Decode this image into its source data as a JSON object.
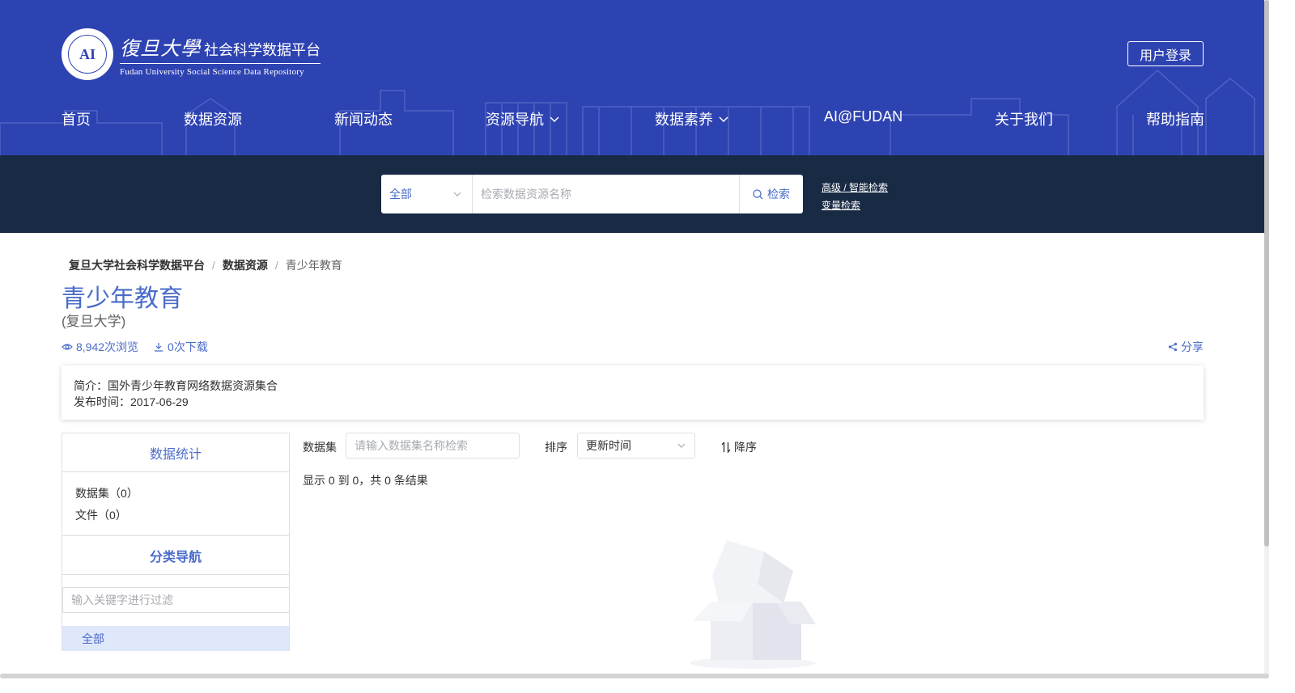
{
  "header": {
    "logo": {
      "seal_text": "复旦大学社会科学数据平台",
      "calligraphy": "復旦大學",
      "name_cn": "社会科学数据平台",
      "name_en": "Fudan University Social Science Data Repository"
    },
    "login_label": "用户登录",
    "nav": [
      {
        "label": "首页",
        "has_dropdown": false
      },
      {
        "label": "数据资源",
        "has_dropdown": false
      },
      {
        "label": "新闻动态",
        "has_dropdown": false
      },
      {
        "label": "资源导航",
        "has_dropdown": true
      },
      {
        "label": "数据素养",
        "has_dropdown": true
      },
      {
        "label": "AI@FUDAN",
        "has_dropdown": false
      },
      {
        "label": "关于我们",
        "has_dropdown": false
      },
      {
        "label": "帮助指南",
        "has_dropdown": false
      }
    ]
  },
  "search": {
    "scope_value": "全部",
    "placeholder": "检索数据资源名称",
    "button_label": "检索",
    "advanced_link": "高级 / 智能检索",
    "variable_link": "变量检索"
  },
  "breadcrumb": {
    "items": [
      "复旦大学社会科学数据平台",
      "数据资源"
    ],
    "current": "青少年教育",
    "separator": "/"
  },
  "page": {
    "title": "青少年教育",
    "subtitle": "(复旦大学)",
    "views": "8,942次浏览",
    "downloads": "0次下载",
    "share_label": "分享"
  },
  "info": {
    "intro": "简介：国外青少年教育网络数据资源集合",
    "publish": "发布时间：2017-06-29"
  },
  "sidebar": {
    "stats_title": "数据统计",
    "stats": [
      "数据集（0）",
      "文件（0）"
    ],
    "nav_title": "分类导航",
    "filter_placeholder": "输入关键字进行过滤",
    "tree": [
      "全部"
    ]
  },
  "main": {
    "dataset_label": "数据集",
    "dataset_placeholder": "请输入数据集名称检索",
    "sort_label": "排序",
    "sort_value": "更新时间",
    "order_label": "降序",
    "result_text": "显示 0 到 0，共 0 条结果"
  },
  "colors": {
    "header_bg": "#2e43b2",
    "search_band_bg": "#182a44",
    "accent": "#4a6cc9",
    "selected_bg": "#dfe7fb"
  }
}
